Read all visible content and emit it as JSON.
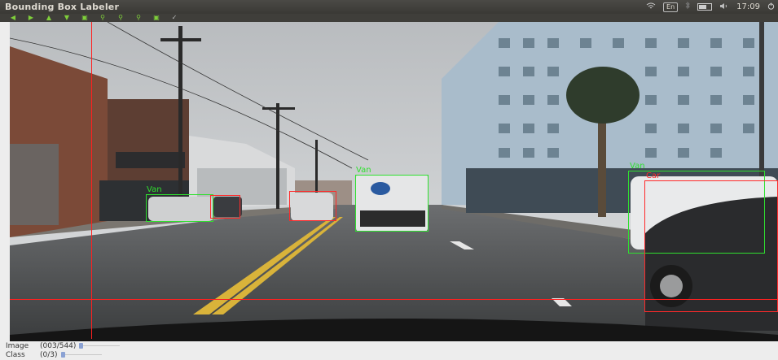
{
  "window": {
    "title": "Bounding Box Labeler"
  },
  "tray": {
    "keyboard": "En",
    "clock": "17:09"
  },
  "toolbar": [
    {
      "icon": "arrow-left-icon"
    },
    {
      "icon": "arrow-right-icon"
    },
    {
      "icon": "arrow-up-icon"
    },
    {
      "icon": "arrow-down-icon"
    },
    {
      "icon": "save-icon"
    },
    {
      "icon": "zoom-icon"
    },
    {
      "icon": "zoom-in-icon"
    },
    {
      "icon": "zoom-out-icon"
    },
    {
      "icon": "save-as-icon"
    },
    {
      "icon": "edit-icon"
    }
  ],
  "annotations": [
    {
      "label": "Van",
      "color": "green"
    },
    {
      "label": "",
      "color": "red"
    },
    {
      "label": "Van",
      "color": "green"
    },
    {
      "label": "Van",
      "color": "green"
    },
    {
      "label": "Car",
      "color": "red"
    },
    {
      "label": "",
      "color": "red"
    }
  ],
  "status": {
    "image_label": "Image",
    "image_value": "(003/544)",
    "image_progress": 0.0055,
    "class_label": "Class",
    "class_value": "(0/3)",
    "class_progress": 0.0
  },
  "colors": {
    "box_green": "#2fe02f",
    "box_red": "#ff2a2a",
    "crosshair": "#ff2020",
    "slider_thumb": "#8ba2d4"
  }
}
